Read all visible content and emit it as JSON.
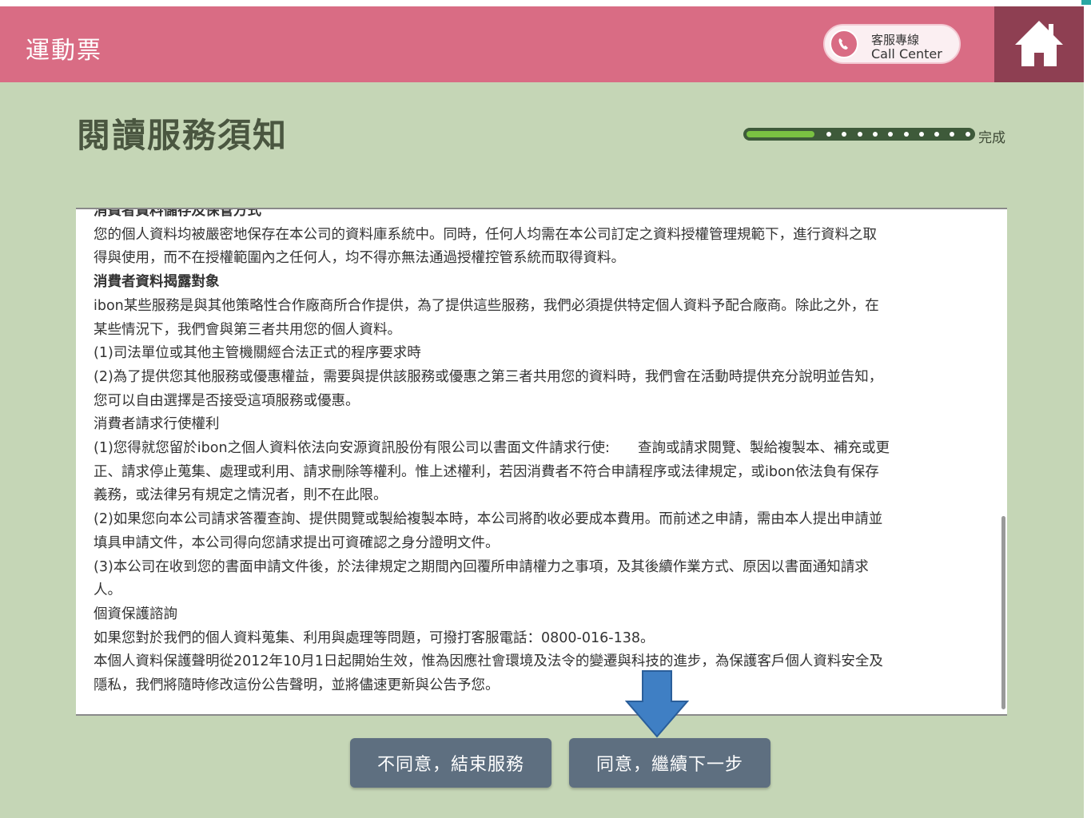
{
  "header": {
    "app_title": "運動票",
    "call_center_zh": "客服專線",
    "call_center_en": "Call Center",
    "home_icon": "home-icon",
    "phone_icon": "phone-icon"
  },
  "page": {
    "title": "閱讀服務須知",
    "progress_label": "完成",
    "progress_fraction": 0.3
  },
  "notice": {
    "lines": [
      {
        "text": "消費者資料儲存及保管方式",
        "bold": true
      },
      {
        "text": "您的個人資料均被嚴密地保存在本公司的資料庫系統中。同時，任何人均需在本公司訂定之資料授權管理規範下，進行資料之取",
        "bold": false
      },
      {
        "text": "得與使用，而不在授權範圍內之任何人，均不得亦無法通過授權控管系統而取得資料。",
        "bold": false
      },
      {
        "text": "消費者資料揭露對象",
        "bold": true
      },
      {
        "text": "ibon某些服務是與其他策略性合作廠商所合作提供，為了提供這些服務，我們必須提供特定個人資料予配合廠商。除此之外，在",
        "bold": false
      },
      {
        "text": "某些情況下，我們會與第三者共用您的個人資料。",
        "bold": false
      },
      {
        "text": "(1)司法單位或其他主管機關經合法正式的程序要求時",
        "bold": false
      },
      {
        "text": "(2)為了提供您其他服務或優惠權益，需要與提供該服務或優惠之第三者共用您的資料時，我們會在活動時提供充分說明並告知，",
        "bold": false
      },
      {
        "text": "您可以自由選擇是否接受這項服務或優惠。",
        "bold": false
      },
      {
        "text": "消費者請求行使權利",
        "bold": false
      },
      {
        "text": "(1)您得就您留於ibon之個人資料依法向安源資訊股份有限公司以書面文件請求行使:　　查詢或請求閱覽、製給複製本、補充或更",
        "bold": false
      },
      {
        "text": "正、請求停止蒐集、處理或利用、請求刪除等權利。惟上述權利，若因消費者不符合申請程序或法律規定，或ibon依法負有保存",
        "bold": false
      },
      {
        "text": "義務，或法律另有規定之情況者，則不在此限。",
        "bold": false
      },
      {
        "text": "(2)如果您向本公司請求答覆查詢、提供閱覽或製給複製本時，本公司將酌收必要成本費用。而前述之申請，需由本人提出申請並",
        "bold": false
      },
      {
        "text": "填具申請文件，本公司得向您請求提出可資確認之身分證明文件。",
        "bold": false
      },
      {
        "text": "(3)本公司在收到您的書面申請文件後，於法律規定之期間內回覆所申請權力之事項，及其後續作業方式、原因以書面通知請求",
        "bold": false
      },
      {
        "text": "人。",
        "bold": false
      },
      {
        "text": "個資保護諮詢",
        "bold": false
      },
      {
        "text": "如果您對於我們的個人資料蒐集、利用與處理等問題，可撥打客服電話：0800-016-138。",
        "bold": false
      },
      {
        "text": "本個人資料保護聲明從2012年10月1日起開始生效，惟為因應社會環境及法令的變遷與科技的進步，為保護客戶個人資料安全及",
        "bold": false
      },
      {
        "text": "隱私，我們將隨時修改這份公告聲明，並將儘速更新與公告予您。",
        "bold": false
      }
    ]
  },
  "buttons": {
    "disagree": "不同意，結束服務",
    "agree": "同意，繼續下一步"
  },
  "colors": {
    "header_bg": "#d96c84",
    "home_bg": "#8e3f52",
    "page_bg": "#c5d6b6",
    "button_bg": "#5e6f80",
    "arrow": "#3f7fc4",
    "progress_fill": "#7ac142"
  }
}
